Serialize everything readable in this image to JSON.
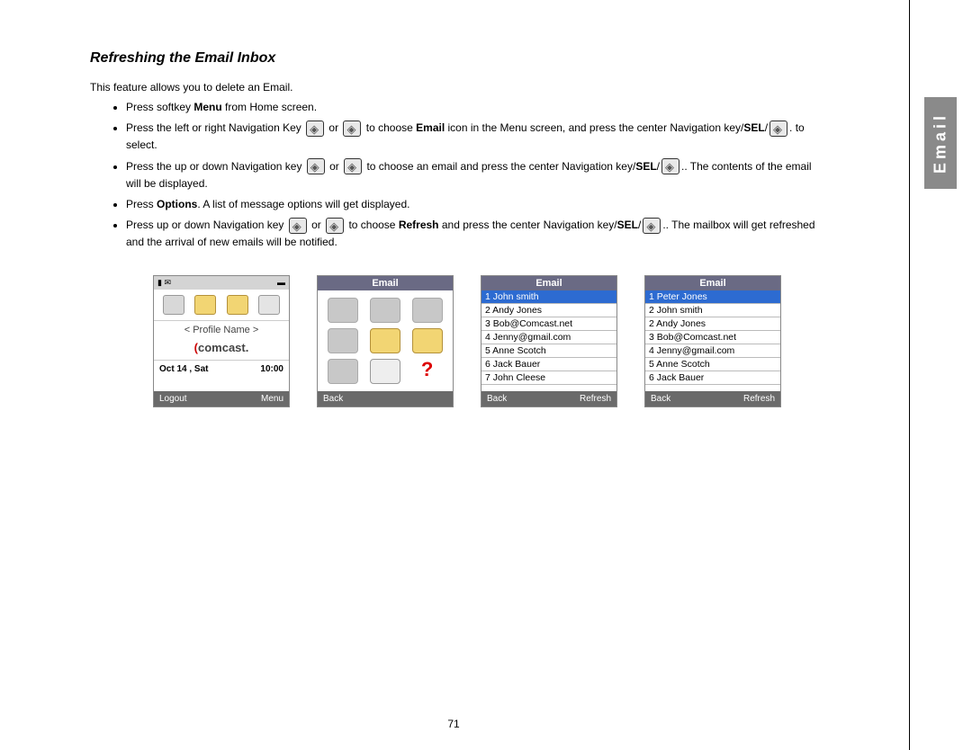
{
  "heading": "Refreshing the Email Inbox",
  "intro": "This feature allows you to delete an Email.",
  "bullets": {
    "b1a": "Press softkey ",
    "b1b": "Menu",
    "b1c": " from Home screen.",
    "b2a": "Press the left or right Navigation Key ",
    "b2b": " or ",
    "b2c": "  to choose ",
    "b2d": "Email",
    "b2e": " icon in the Menu screen, and press the center Navigation key/",
    "b2f": "SEL",
    "b2g": ". to select.",
    "b3a": "Press the up or down Navigation key ",
    "b3b": " or ",
    "b3c": "  to choose an email and press the center Navigation key/",
    "b3d": "SEL",
    "b3e": ".. The contents of the email will be displayed.",
    "b4a": "Press ",
    "b4b": "Options",
    "b4c": ". A list of message options will get displayed.",
    "b5a": "Press up or down Navigation key ",
    "b5b": " or ",
    "b5c": "  to choose ",
    "b5d": "Refresh",
    "b5e": " and press the center Navigation key/",
    "b5f": "SEL",
    "b5g": ".. The mailbox will get refreshed and the arrival of new emails will be notified."
  },
  "screens": {
    "home": {
      "profile": "< Profile Name >",
      "logo": "comcast.",
      "date": "Oct 14 , Sat",
      "time": "10:00",
      "softLeft": "Logout",
      "softRight": "Menu"
    },
    "menu": {
      "title": "Email",
      "softLeft": "Back",
      "softRight": ""
    },
    "inbox1": {
      "title": "Email",
      "items": [
        "1 John smith",
        "2 Andy Jones",
        "3 Bob@Comcast.net",
        "4 Jenny@gmail.com",
        "5 Anne Scotch",
        "6 Jack Bauer",
        "7 John Cleese"
      ],
      "softLeft": "Back",
      "softRight": "Refresh"
    },
    "inbox2": {
      "title": "Email",
      "items": [
        "1 Peter Jones",
        "2 John smith",
        "2 Andy Jones",
        "3 Bob@Comcast.net",
        "4 Jenny@gmail.com",
        "5 Anne Scotch",
        "6 Jack Bauer"
      ],
      "softLeft": "Back",
      "softRight": "Refresh"
    }
  },
  "pageNumber": "71",
  "sideTab": "Email"
}
